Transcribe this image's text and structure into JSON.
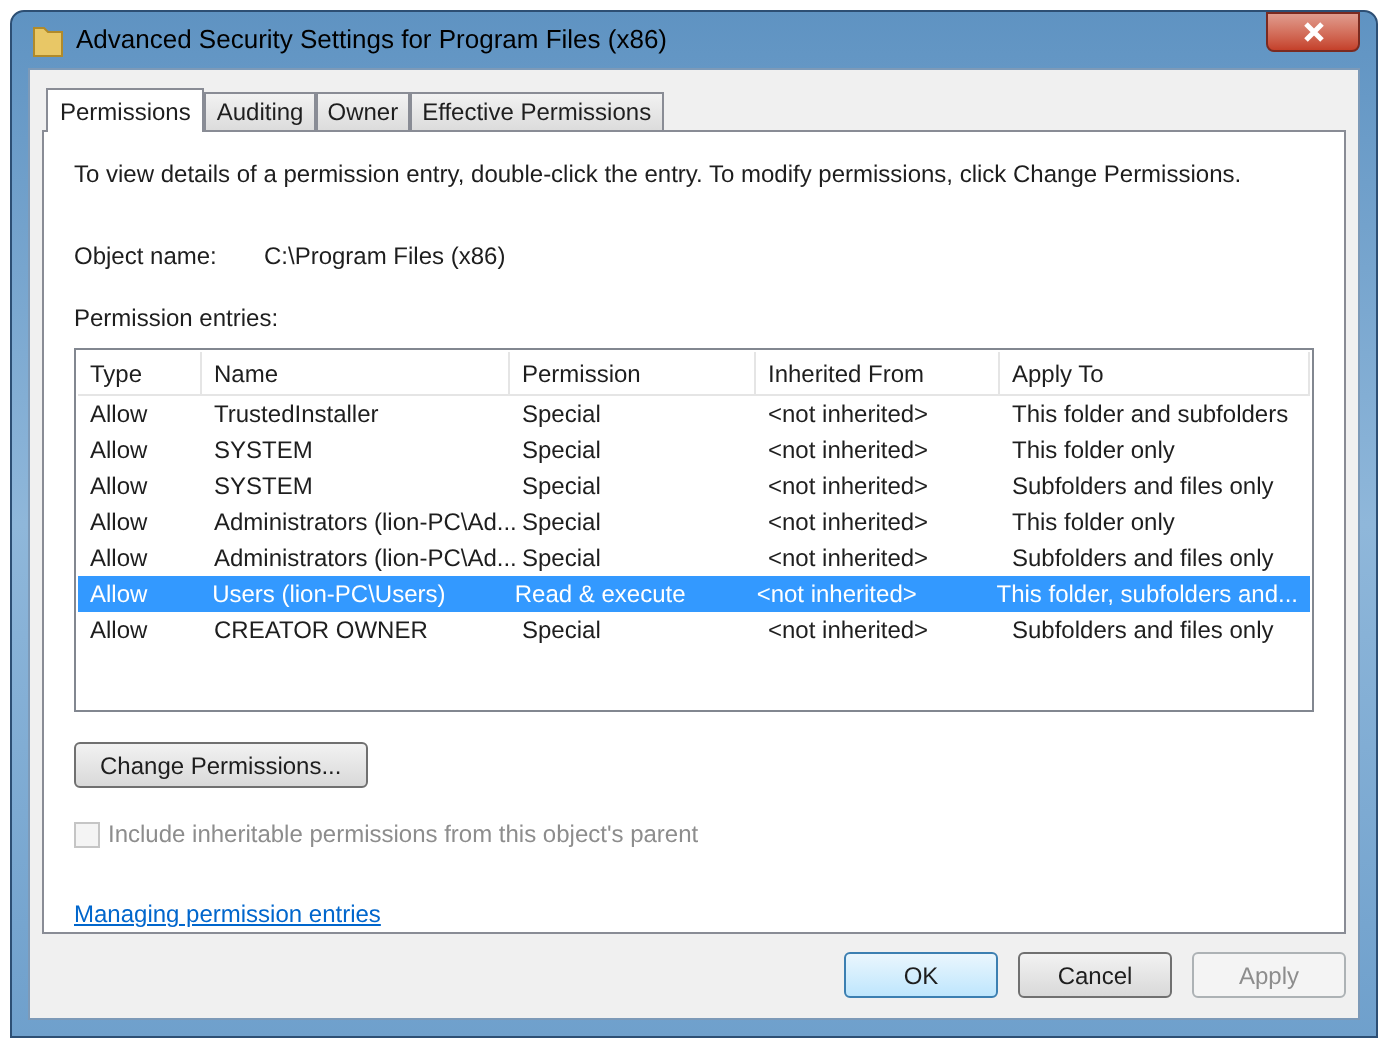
{
  "window": {
    "title": "Advanced Security Settings for Program Files (x86)"
  },
  "tabs": [
    {
      "label": "Permissions",
      "selected": true
    },
    {
      "label": "Auditing",
      "selected": false
    },
    {
      "label": "Owner",
      "selected": false
    },
    {
      "label": "Effective Permissions",
      "selected": false
    }
  ],
  "instructions": "To view details of a permission entry, double-click the entry. To modify permissions, click Change Permissions.",
  "object_name": {
    "label": "Object name:",
    "value": "C:\\Program Files (x86)"
  },
  "entries_label": "Permission entries:",
  "table": {
    "columns": [
      "Type",
      "Name",
      "Permission",
      "Inherited From",
      "Apply To"
    ],
    "rows": [
      {
        "cells": [
          "Allow",
          "TrustedInstaller",
          "Special",
          "<not inherited>",
          "This folder and subfolders"
        ],
        "selected": false
      },
      {
        "cells": [
          "Allow",
          "SYSTEM",
          "Special",
          "<not inherited>",
          "This folder only"
        ],
        "selected": false
      },
      {
        "cells": [
          "Allow",
          "SYSTEM",
          "Special",
          "<not inherited>",
          "Subfolders and files only"
        ],
        "selected": false
      },
      {
        "cells": [
          "Allow",
          "Administrators (lion-PC\\Ad...",
          "Special",
          "<not inherited>",
          "This folder only"
        ],
        "selected": false
      },
      {
        "cells": [
          "Allow",
          "Administrators (lion-PC\\Ad...",
          "Special",
          "<not inherited>",
          "Subfolders and files only"
        ],
        "selected": false
      },
      {
        "cells": [
          "Allow",
          "Users (lion-PC\\Users)",
          "Read & execute",
          "<not inherited>",
          "This folder, subfolders and..."
        ],
        "selected": true
      },
      {
        "cells": [
          "Allow",
          "CREATOR OWNER",
          "Special",
          "<not inherited>",
          "Subfolders and files only"
        ],
        "selected": false
      }
    ]
  },
  "change_button": "Change Permissions...",
  "include_checkbox": {
    "label": "Include inheritable permissions from this object's parent",
    "checked": false,
    "disabled": true
  },
  "help_link": "Managing permission entries",
  "buttons": [
    {
      "label": "OK",
      "default": true,
      "disabled": false
    },
    {
      "label": "Cancel",
      "default": false,
      "disabled": false
    },
    {
      "label": "Apply",
      "default": false,
      "disabled": true
    }
  ]
}
